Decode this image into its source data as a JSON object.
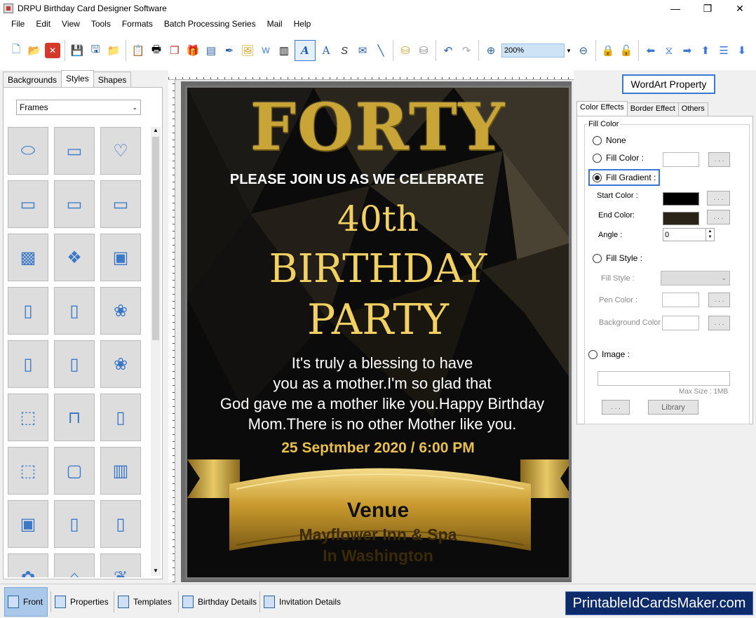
{
  "window": {
    "title": "DRPU Birthday Card Designer Software",
    "min": "—",
    "max": "❐",
    "close": "✕"
  },
  "menu": [
    "File",
    "Edit",
    "View",
    "Tools",
    "Formats",
    "Batch Processing Series",
    "Mail",
    "Help"
  ],
  "toolbar": {
    "zoom_value": "200%"
  },
  "left_panel": {
    "tabs": [
      "Backgrounds",
      "Styles",
      "Shapes"
    ],
    "active_tab": "Styles",
    "dropdown_value": "Frames"
  },
  "card": {
    "headline": "FORTY",
    "invite": "PLEASE JOIN US AS WE CELEBRATE",
    "ordinal": "40th",
    "line_birthday": "BIRTHDAY",
    "line_party": "PARTY",
    "message": [
      "It's truly a blessing to have",
      "you as a mother.I'm so glad that",
      "God gave me a mother like you.Happy Birthday",
      "Mom.There is no other Mother like you."
    ],
    "date": "25 Septmber 2020 / 6:00 PM",
    "venue_label": "Venue",
    "venue_name": "Mayflower Inn & Spa",
    "venue_city": "In Washington"
  },
  "right_panel": {
    "title": "WordArt Property",
    "tabs": [
      "Color Effects",
      "Border Effect",
      "Others"
    ],
    "group_label": "Fill Color",
    "opt_none": "None",
    "opt_fill_color": "Fill Color :",
    "opt_fill_gradient": "Fill Gradient :",
    "start_color_label": "Start Color :",
    "end_color_label": "End Color:",
    "angle_label": "Angle :",
    "angle_value": "0",
    "opt_fill_style": "Fill Style :",
    "fill_style_label": "Fill Style :",
    "pen_color_label": "Pen Color :",
    "bg_color_label": "Background Color :",
    "opt_image": "Image :",
    "max_size": "Max Size : 1MB",
    "dots": ". . .",
    "library": "Library",
    "start_color": "#000000",
    "end_color": "#2a2418"
  },
  "bottom_tabs": [
    "Front",
    "Properties",
    "Templates",
    "Birthday Details",
    "Invitation Details"
  ],
  "brand": "PrintableIdCardsMaker.com"
}
